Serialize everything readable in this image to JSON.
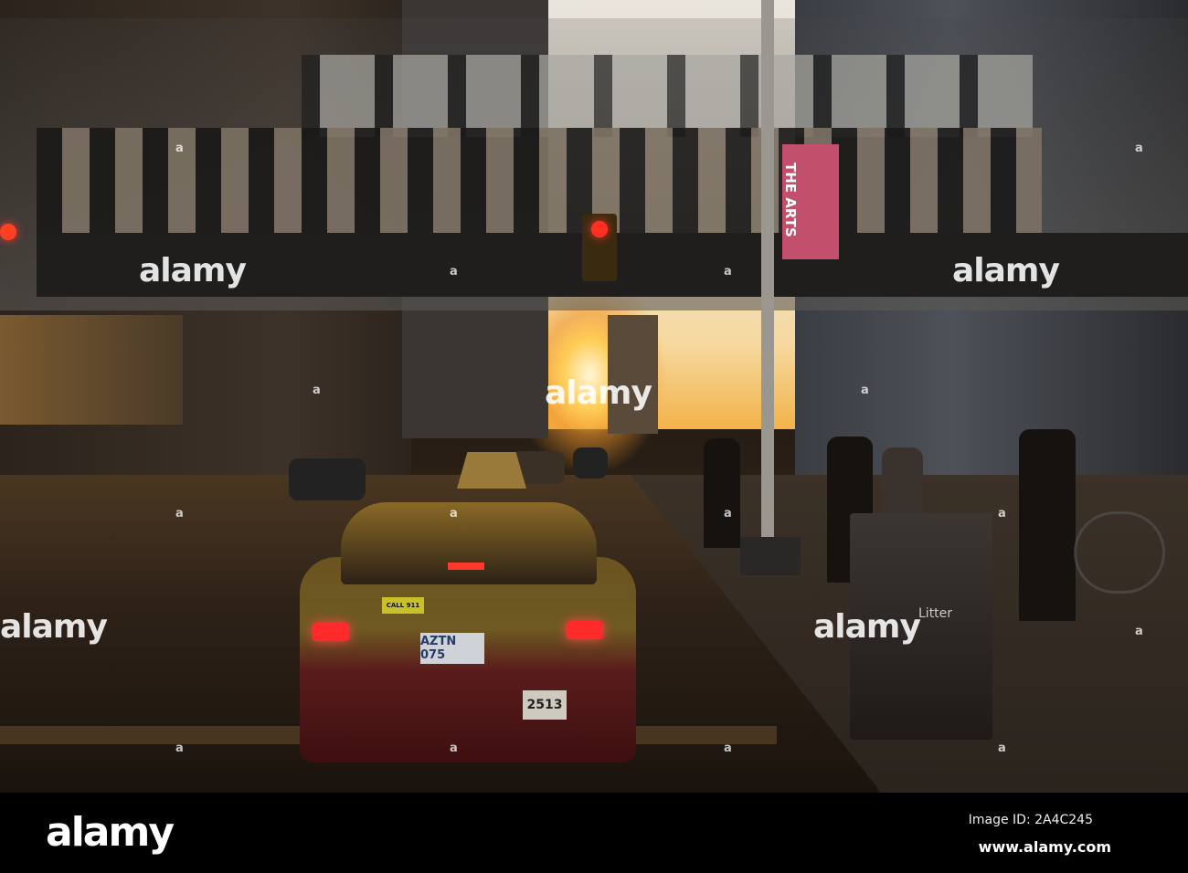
{
  "scene": {
    "banner_text": "THE ARTS",
    "taxi": {
      "plate": "AZTN 075",
      "number_plate": "2513",
      "sticker": "CALL 911"
    },
    "bin_label": "Litter"
  },
  "watermark": {
    "text": "alamy",
    "dot": "a"
  },
  "footer": {
    "logo": "alamy",
    "image_id": "Image ID: 2A4C245",
    "site": "www.alamy.com"
  }
}
